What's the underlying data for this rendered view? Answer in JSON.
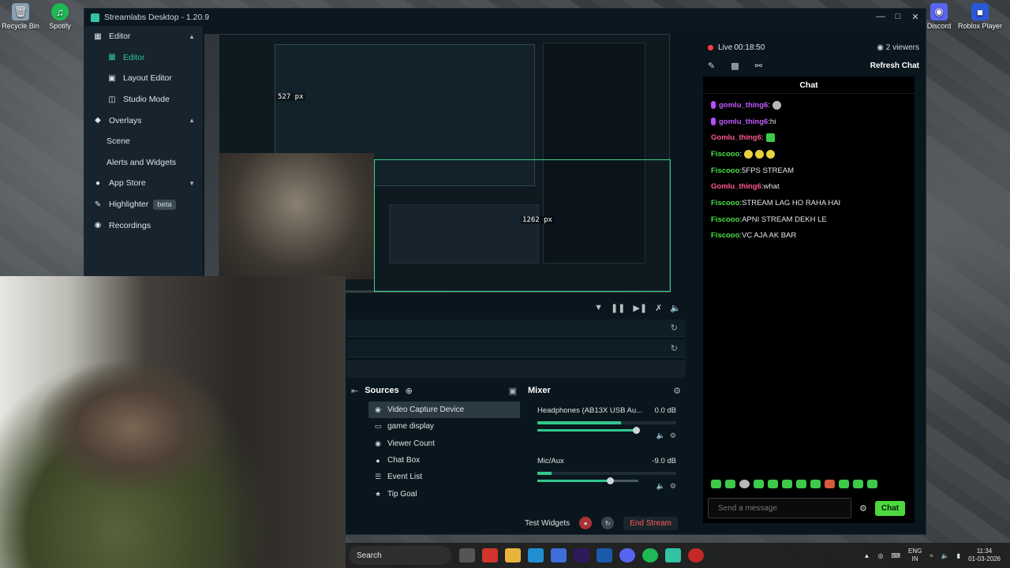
{
  "desktop": {
    "icons_left": [
      {
        "label": "Recycle Bin"
      },
      {
        "label": "Spotify"
      }
    ],
    "icons_right": [
      {
        "label": "Discord"
      },
      {
        "label": "Roblox Player"
      }
    ]
  },
  "window": {
    "title": "Streamlabs Desktop - 1.20.9"
  },
  "sidebar": {
    "items": [
      {
        "label": "Editor",
        "level": "top",
        "icon": "editor-icon",
        "chevron": "up"
      },
      {
        "label": "Editor",
        "level": "sub",
        "icon": "editor-icon",
        "active": true
      },
      {
        "label": "Layout Editor",
        "level": "sub",
        "icon": "layout-icon"
      },
      {
        "label": "Studio Mode",
        "level": "sub",
        "icon": "studio-icon"
      },
      {
        "label": "Overlays",
        "level": "top",
        "icon": "overlays-icon",
        "chevron": "up"
      },
      {
        "label": "Scene",
        "level": "sub"
      },
      {
        "label": "Alerts and Widgets",
        "level": "sub"
      },
      {
        "label": "App Store",
        "level": "top",
        "icon": "store-icon",
        "chevron": "down"
      },
      {
        "label": "Highlighter",
        "level": "top",
        "icon": "highlighter-icon",
        "badge": "beta"
      },
      {
        "label": "Recordings",
        "level": "top",
        "icon": "recordings-icon"
      }
    ]
  },
  "preview": {
    "width_label": "527 px",
    "height_label": "1262 px"
  },
  "sources": {
    "title": "Sources",
    "items": [
      {
        "label": "Video Capture Device",
        "icon": "camera-icon",
        "selected": true
      },
      {
        "label": "game display",
        "icon": "monitor-icon"
      },
      {
        "label": "Viewer Count",
        "icon": "eye-icon"
      },
      {
        "label": "Chat Box",
        "icon": "chat-icon"
      },
      {
        "label": "Event List",
        "icon": "list-icon"
      },
      {
        "label": "Tip Goal",
        "icon": "goal-icon"
      }
    ]
  },
  "mixer": {
    "title": "Mixer",
    "channels": [
      {
        "name": "Headphones (AB13X USB Au...",
        "level": "0.0 dB",
        "meter": 0.6,
        "volume": 0.98
      },
      {
        "name": "Mic/Aux",
        "level": "-9.0 dB",
        "meter": 0.1,
        "volume": 0.72
      }
    ]
  },
  "footer": {
    "test_widgets": "Test Widgets",
    "end_stream": "End Stream"
  },
  "stream": {
    "live_label": "Live",
    "live_time": "00:18:50",
    "viewers": "2 viewers",
    "refresh_chat": "Refresh Chat"
  },
  "chat": {
    "title": "Chat",
    "messages": [
      {
        "user": "gomlu_thing6",
        "text": "",
        "color": "#c15bff",
        "badge": true,
        "emoji": 1
      },
      {
        "user": "gomlu_thing6",
        "text": " hi",
        "color": "#c15bff",
        "badge": true
      },
      {
        "user": "Gomlu_thing6",
        "text": "",
        "color": "#ff5a8a",
        "emoji": 1
      },
      {
        "user": "Fiscooo",
        "text": "",
        "color": "#4ae04a",
        "emoji": 3
      },
      {
        "user": "Fiscooo",
        "text": " 5FPS STREAM",
        "color": "#4ae04a"
      },
      {
        "user": "Gomlu_thing6",
        "text": " what",
        "color": "#ff5a8a"
      },
      {
        "user": "Fiscooo",
        "text": " STREAM LAG HO RAHA HAI",
        "color": "#4ae04a"
      },
      {
        "user": "Fiscooo",
        "text": " APNI STREAM DEKH LE",
        "color": "#4ae04a"
      },
      {
        "user": "Fiscooo",
        "text": " VC AJA AK BAR",
        "color": "#4ae04a"
      }
    ],
    "input_placeholder": "Send a message",
    "send_label": "Chat"
  },
  "taskbar": {
    "search": "Search",
    "lang": "ENG",
    "region": "IN",
    "time": "11:34",
    "date": "01-03-2026"
  },
  "colors": {
    "accent": "#31c3a2",
    "live": "#ff4040",
    "chat_send": "#4cd93f",
    "end_stream": "#ff5a5a"
  }
}
